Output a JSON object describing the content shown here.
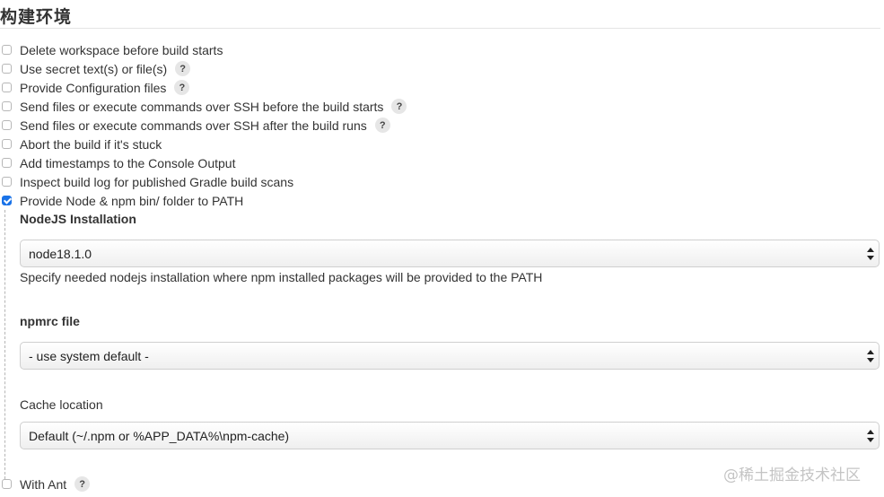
{
  "section": {
    "title": "构建环境"
  },
  "options": [
    {
      "label": "Delete workspace before build starts",
      "checked": false,
      "help": false
    },
    {
      "label": "Use secret text(s) or file(s)",
      "checked": false,
      "help": true
    },
    {
      "label": "Provide Configuration files",
      "checked": false,
      "help": true
    },
    {
      "label": "Send files or execute commands over SSH before the build starts",
      "checked": false,
      "help": true
    },
    {
      "label": "Send files or execute commands over SSH after the build runs",
      "checked": false,
      "help": true
    },
    {
      "label": "Abort the build if it's stuck",
      "checked": false,
      "help": false
    },
    {
      "label": "Add timestamps to the Console Output",
      "checked": false,
      "help": false
    },
    {
      "label": "Inspect build log for published Gradle build scans",
      "checked": false,
      "help": false
    },
    {
      "label": "Provide Node & npm bin/ folder to PATH",
      "checked": true,
      "help": false
    }
  ],
  "help_symbol": "?",
  "node": {
    "installation_label": "NodeJS Installation",
    "installation_value": "node18.1.0",
    "installation_desc": "Specify needed nodejs installation where npm installed packages will be provided to the PATH",
    "npmrc_label": "npmrc file",
    "npmrc_value": "- use system default -",
    "cache_label": "Cache location",
    "cache_value": "Default (~/.npm or %APP_DATA%\\npm-cache)"
  },
  "with_ant": {
    "label": "With Ant",
    "checked": false,
    "help": true
  },
  "watermark": "@稀土掘金技术社区"
}
